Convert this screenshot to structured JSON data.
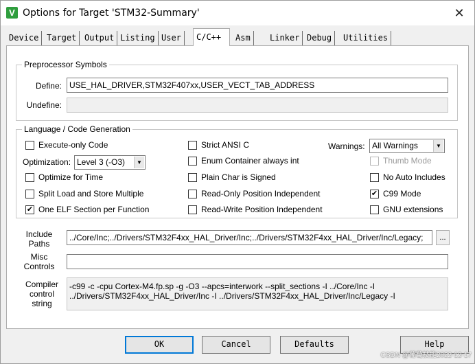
{
  "window": {
    "title": "Options for Target 'STM32-Summary'",
    "app_icon": "keil-uvision-icon",
    "close_icon": "✕"
  },
  "tabs": [
    "Device",
    "Target",
    "Output",
    "Listing",
    "User",
    "C/C++",
    "Asm",
    "Linker",
    "Debug",
    "Utilities"
  ],
  "active_tab": "C/C++",
  "preprocessor": {
    "title": "Preprocessor Symbols",
    "define_label": "Define:",
    "define_value": "USE_HAL_DRIVER,STM32F407xx,USER_VECT_TAB_ADDRESS",
    "undefine_label": "Undefine:",
    "undefine_value": ""
  },
  "codegen": {
    "title": "Language / Code Generation",
    "left_checks": [
      {
        "label": "Execute-only Code",
        "checked": false
      },
      {
        "label": "Optimize for Time",
        "checked": false
      },
      {
        "label": "Split Load and Store Multiple",
        "checked": false
      },
      {
        "label": "One ELF Section per Function",
        "checked": true
      }
    ],
    "optimization_label": "Optimization:",
    "optimization_value": "Level 3 (-O3)",
    "mid_checks": [
      {
        "label": "Strict ANSI C",
        "checked": false
      },
      {
        "label": "Enum Container always int",
        "checked": false
      },
      {
        "label": "Plain Char is Signed",
        "checked": false
      },
      {
        "label": "Read-Only Position Independent",
        "checked": false
      },
      {
        "label": "Read-Write Position Independent",
        "checked": false
      }
    ],
    "warnings_label": "Warnings:",
    "warnings_value": "All Warnings",
    "right_checks": [
      {
        "label": "Thumb Mode",
        "checked": false,
        "disabled": true
      },
      {
        "label": "No Auto Includes",
        "checked": false,
        "disabled": false
      },
      {
        "label": "C99 Mode",
        "checked": true,
        "disabled": false
      },
      {
        "label": "GNU extensions",
        "checked": false,
        "disabled": false
      }
    ]
  },
  "include": {
    "label_line1": "Include",
    "label_line2": "Paths",
    "value": "../Core/Inc;../Drivers/STM32F4xx_HAL_Driver/Inc;../Drivers/STM32F4xx_HAL_Driver/Inc/Legacy;",
    "browse_label": "..."
  },
  "misc": {
    "label_line1": "Misc",
    "label_line2": "Controls",
    "value": ""
  },
  "compiler": {
    "label_line1": "Compiler",
    "label_line2": "control",
    "label_line3": "string",
    "line1": "-c99 -c -cpu Cortex-M4.fp.sp -g -O3 --apcs=interwork --split_sections -I ../Core/Inc -I",
    "line2": "../Drivers/STM32F4xx_HAL_Driver/Inc -I ../Drivers/STM32F4xx_HAL_Driver/Inc/Legacy -I"
  },
  "buttons": {
    "ok": "OK",
    "cancel": "Cancel",
    "defaults": "Defaults",
    "help": "Help"
  },
  "watermark": "CSDN @葡萄技能2022-12-17"
}
